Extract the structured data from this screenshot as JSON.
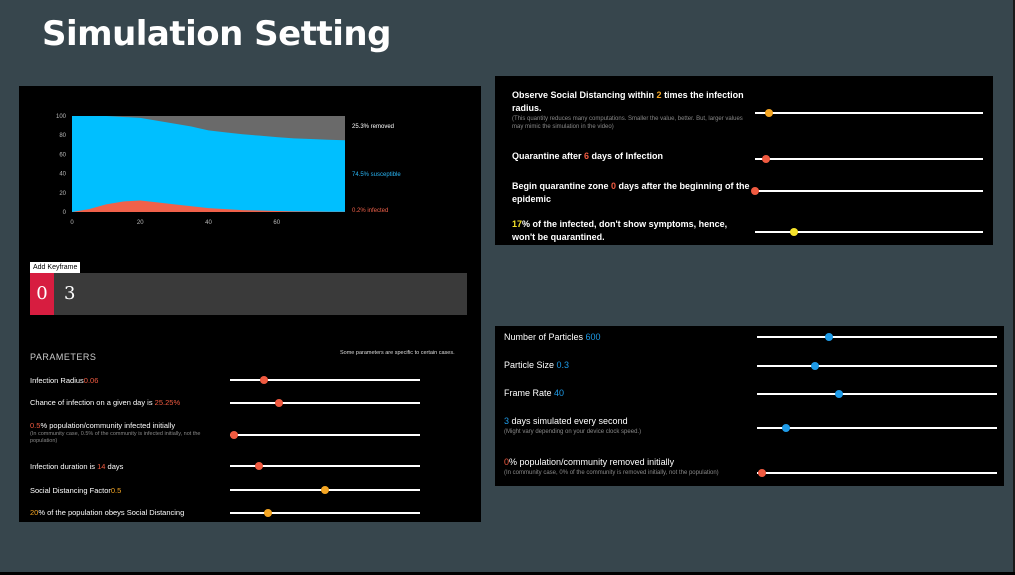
{
  "title": "Simulation Setting",
  "chart": {
    "y_ticks": [
      "100",
      "80",
      "60",
      "40",
      "20",
      "0"
    ],
    "x_ticks": [
      "0",
      "20",
      "40",
      "60"
    ],
    "legend": [
      {
        "label": "25.3% removed",
        "color": "#ffffff"
      },
      {
        "label": "74.5% susceptible",
        "color": "#29b6f6"
      },
      {
        "label": "0.2% infected",
        "color": "#f0614a"
      }
    ],
    "colors": {
      "removed": "#6a6a6a",
      "susceptible": "#00bfff",
      "infected": "#f0614a"
    }
  },
  "chart_data": {
    "type": "area",
    "x": [
      0,
      5,
      10,
      15,
      20,
      25,
      30,
      35,
      40,
      45,
      50,
      55,
      60,
      65,
      70,
      75,
      80
    ],
    "series": [
      {
        "name": "infected",
        "values": [
          0,
          3,
          8,
          11,
          12,
          10,
          8,
          6,
          4,
          3,
          2,
          1.5,
          1,
          0.7,
          0.5,
          0.3,
          0.2
        ]
      },
      {
        "name": "susceptible",
        "values": [
          100,
          97,
          92,
          88,
          86,
          85,
          84,
          83,
          81,
          80,
          79,
          78,
          77,
          76,
          75.5,
          75,
          74.5
        ]
      },
      {
        "name": "removed",
        "values": [
          0,
          0,
          0,
          1,
          2,
          5,
          8,
          11,
          15,
          17,
          19,
          20.5,
          22,
          23.3,
          24,
          24.7,
          25.3
        ]
      }
    ],
    "xlim": [
      0,
      80
    ],
    "ylim": [
      0,
      100
    ]
  },
  "keyframe": {
    "button_label": "Add Keyframe",
    "frames": [
      "0",
      "3"
    ]
  },
  "parameters": {
    "heading": "PARAMETERS",
    "note": "Some parameters are specific to certain cases.",
    "rows": [
      {
        "pre": "Infection Radius",
        "value": "0.06",
        "post": "",
        "sub": "",
        "slider": 0.18,
        "color": "#f05a40"
      },
      {
        "pre": "Chance of infection on a given day is ",
        "value": "25.25%",
        "post": "",
        "sub": "",
        "slider": 0.26,
        "color": "#f05a40"
      },
      {
        "pre": "",
        "value": "0.5",
        "post": "% population/community infected initially",
        "sub": "(In community case, 0.5% of the community is infected initially, not the population)",
        "slider": 0.02,
        "color": "#f05a40"
      },
      {
        "pre": "Infection duration is ",
        "value": "14",
        "post": " days",
        "sub": "",
        "slider": 0.15,
        "color": "#f05a40"
      },
      {
        "pre": "Social Distancing Factor",
        "value": "0.5",
        "post": "",
        "sub": "",
        "slider": 0.5,
        "color": "#f5a623"
      },
      {
        "pre": "",
        "value": "20",
        "post": "% of the population obeys Social Distancing",
        "sub": "",
        "slider": 0.2,
        "color": "#f5a623"
      }
    ]
  },
  "right_top": {
    "rows": [
      {
        "pre": "Observe Social Distancing within ",
        "value": "2",
        "post": " times the infection radius.",
        "sub": "(This quantity reduces many computations. Smaller the value, better. But, larger values may mimic the simulation in the video)",
        "slider": 0.06,
        "color": "#f5a623"
      },
      {
        "pre": "Quarantine after ",
        "value": "6",
        "post": " days of Infection",
        "sub": "",
        "slider": 0.05,
        "color": "#f05a40"
      },
      {
        "pre": "Begin quarantine zone ",
        "value": "0",
        "post": " days after the beginning of the epidemic",
        "sub": "",
        "slider": 0.0,
        "color": "#f05a40"
      },
      {
        "pre": "",
        "value": "17",
        "post": "% of the infected, don't show symptoms, hence, won't be quarantined.",
        "sub": "",
        "slider": 0.17,
        "color": "#f5e22a"
      }
    ]
  },
  "right_bottom": {
    "rows": [
      {
        "pre": "Number of Particles ",
        "value": "600",
        "post": "",
        "sub": "",
        "slider": 0.3,
        "color": "#1e9be8"
      },
      {
        "pre": "Particle Size ",
        "value": "0.3",
        "post": "",
        "sub": "",
        "slider": 0.24,
        "color": "#1e9be8"
      },
      {
        "pre": "Frame Rate ",
        "value": "40",
        "post": "",
        "sub": "",
        "slider": 0.34,
        "color": "#1e9be8"
      },
      {
        "pre": "",
        "value": "3",
        "post": " days simulated every second",
        "sub": "(Might vary depending on your device clock speed.)",
        "slider": 0.12,
        "color": "#1e9be8"
      },
      {
        "pre": "",
        "value": "0",
        "post": "% population/community removed initially",
        "sub": "(In community case, 0% of the community is removed initially, not the population)",
        "slider": 0.02,
        "color": "#f05a40"
      }
    ]
  }
}
